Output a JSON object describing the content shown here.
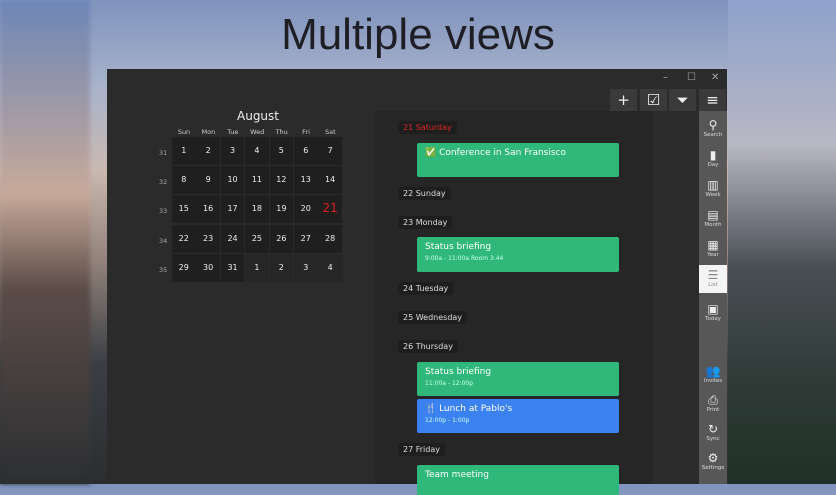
{
  "headline": "Multiple views",
  "window_controls": {
    "minimize": "–",
    "maximize": "☐",
    "close": "✕"
  },
  "toolbar": [
    {
      "name": "add",
      "icon": "+"
    },
    {
      "name": "task",
      "icon": "☑"
    },
    {
      "name": "filter",
      "icon": "⏷"
    },
    {
      "name": "menu",
      "icon": "≡"
    }
  ],
  "calendar": {
    "month": "August",
    "weekdays": [
      "Sun",
      "Mon",
      "Tue",
      "Wed",
      "Thu",
      "Fri",
      "Sat"
    ],
    "weeks": [
      {
        "num": "31",
        "days": [
          {
            "d": "1"
          },
          {
            "d": "2",
            "bars": [
              "#2fb87a"
            ]
          },
          {
            "d": "3"
          },
          {
            "d": "4"
          },
          {
            "d": "5"
          },
          {
            "d": "6"
          },
          {
            "d": "7",
            "bars": [
              "#3b7de0"
            ]
          }
        ]
      },
      {
        "num": "32",
        "days": [
          {
            "d": "8"
          },
          {
            "d": "9",
            "bars": [
              "#2fb87a"
            ]
          },
          {
            "d": "10",
            "bars": [
              "#e0553a"
            ]
          },
          {
            "d": "11"
          },
          {
            "d": "12",
            "bars": [
              "#2fb87a"
            ]
          },
          {
            "d": "13",
            "bars": [
              "#2fb87a",
              "#3b7de0"
            ]
          },
          {
            "d": "14",
            "bars": [
              "",
              "#3b7de0"
            ]
          }
        ]
      },
      {
        "num": "33",
        "days": [
          {
            "d": "15",
            "bars": [
              "#3b7de0"
            ]
          },
          {
            "d": "16",
            "bars": [
              "#2fb87a"
            ]
          },
          {
            "d": "17"
          },
          {
            "d": "18"
          },
          {
            "d": "19",
            "bars": [
              "#2fb87a"
            ]
          },
          {
            "d": "20",
            "bars": [
              "#2fb87a"
            ]
          },
          {
            "d": "21",
            "today": true,
            "bars": [
              "#2fb87a"
            ]
          }
        ]
      },
      {
        "num": "34",
        "days": [
          {
            "d": "22"
          },
          {
            "d": "23",
            "bars": [
              "#2fb87a"
            ]
          },
          {
            "d": "24"
          },
          {
            "d": "25"
          },
          {
            "d": "26",
            "bars": [
              "#2fb87a",
              "#3b7de0"
            ]
          },
          {
            "d": "27",
            "bars": [
              "#2fb87a",
              "#3b7de0"
            ]
          },
          {
            "d": "28"
          }
        ]
      },
      {
        "num": "35",
        "days": [
          {
            "d": "29"
          },
          {
            "d": "30",
            "bars": [
              "#2fb87a"
            ]
          },
          {
            "d": "31"
          },
          {
            "d": "1",
            "other": true
          },
          {
            "d": "2",
            "other": true
          },
          {
            "d": "3",
            "other": true
          },
          {
            "d": "4",
            "other": true,
            "bars": [
              "#3b7de0"
            ]
          }
        ]
      }
    ]
  },
  "list": {
    "days": [
      {
        "label": "21 Saturday",
        "today": true
      },
      {
        "label": "22 Sunday"
      },
      {
        "label": "23 Monday"
      },
      {
        "label": "24 Tuesday"
      },
      {
        "label": "25 Wednesday"
      },
      {
        "label": "26 Thursday"
      },
      {
        "label": "27 Friday"
      }
    ],
    "events": [
      {
        "title": "✅ Conference in San Fransisco",
        "sub": "",
        "color": "#2fb87a"
      },
      {
        "title": "Status briefing",
        "sub": "9:00a - 11:00a Room 3.44",
        "color": "#2fb87a"
      },
      {
        "title": "Status briefing",
        "sub": "11:00a - 12:00p",
        "color": "#2fb87a"
      },
      {
        "title": "🍴 Lunch at Pablo's",
        "sub": "12:00p - 1:00p",
        "color": "#3b82f0"
      },
      {
        "title": "Team meeting",
        "sub": "",
        "color": "#2fb87a"
      }
    ]
  },
  "sidebar": [
    {
      "label": "Search",
      "icon": "⚲"
    },
    {
      "label": "Day",
      "icon": "▮"
    },
    {
      "label": "Week",
      "icon": "▥"
    },
    {
      "label": "Month",
      "icon": "▤"
    },
    {
      "label": "Year",
      "icon": "▦"
    },
    {
      "label": "List",
      "icon": "☰",
      "active": true
    },
    {
      "label": "Today",
      "icon": "▣"
    },
    {
      "label": "Invites",
      "icon": "👥"
    },
    {
      "label": "Print",
      "icon": "⎙"
    },
    {
      "label": "Sync",
      "icon": "↻"
    },
    {
      "label": "Settings",
      "icon": "⚙"
    }
  ]
}
